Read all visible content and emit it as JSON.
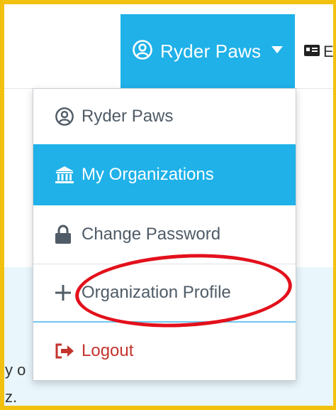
{
  "header": {
    "user_name": "Ryder Paws",
    "language_partial": "E"
  },
  "menu": {
    "items": [
      {
        "label": "Ryder Paws",
        "icon": "user-circle-icon"
      },
      {
        "label": "My Organizations",
        "icon": "bank-icon",
        "active": true
      },
      {
        "label": "Change Password",
        "icon": "lock-icon"
      },
      {
        "label": "Organization Profile",
        "icon": "plus-icon",
        "highlighted": true
      },
      {
        "label": "Logout",
        "icon": "logout-icon"
      }
    ]
  },
  "background": {
    "partial_line1": "y o",
    "partial_line2": "z."
  },
  "colors": {
    "accent": "#1fb1e8",
    "frame": "#f2c10f",
    "annotation_ring": "#e3101b",
    "logout": "#c4332e",
    "menu_text": "#4f5b66"
  }
}
